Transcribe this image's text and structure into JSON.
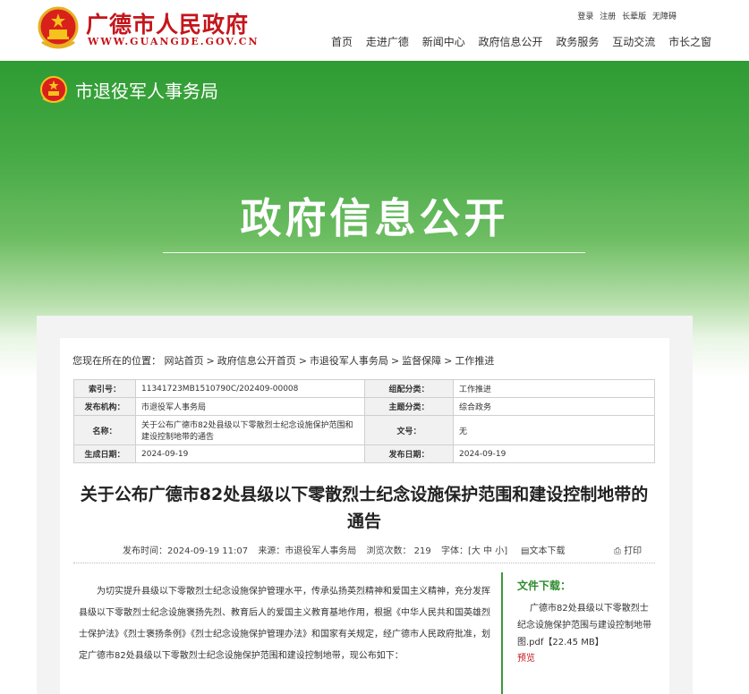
{
  "header": {
    "site_title": "广德市人民政府",
    "site_url": "WWW.GUANGDE.GOV.CN",
    "util": [
      "登录",
      "注册",
      "长辈版",
      "无障碍"
    ],
    "nav": [
      "首页",
      "走进广德",
      "新闻中心",
      "政府信息公开",
      "政务服务",
      "互动交流",
      "市长之窗"
    ]
  },
  "banner": {
    "dept_name": "市退役军人事务局",
    "big_title": "政府信息公开"
  },
  "breadcrumb": {
    "prefix": "您现在所在的位置：",
    "items": [
      "网站首页",
      "政府信息公开首页",
      "市退役军人事务局",
      "监督保障",
      "工作推进"
    ],
    "sep": ">"
  },
  "meta": {
    "index_label": "索引号：",
    "index_value": "11341723MB1510790C/202409-00008",
    "category_label": "组配分类：",
    "category_value": "工作推进",
    "org_label": "发布机构：",
    "org_value": "市退役军人事务局",
    "topic_label": "主题分类：",
    "topic_value": "综合政务",
    "name_label": "名称：",
    "name_value": "关于公布广德市82处县级以下零散烈士纪念设施保护范围和建设控制地带的通告",
    "docno_label": "文号：",
    "docno_value": "无",
    "gen_date_label": "生成日期：",
    "gen_date_value": "2024-09-19",
    "pub_date_label": "发布日期：",
    "pub_date_value": "2024-09-19"
  },
  "article": {
    "title": "关于公布广德市82处县级以下零散烈士纪念设施保护范围和建设控制地带的通告",
    "publish_time": "发布时间：2024-09-19 11:07",
    "source": "来源：市退役军人事务局",
    "views": "浏览次数： 219",
    "font_size": "字体：[大 中 小]",
    "download_link": "文本下载",
    "print_link": "打印",
    "body": "为切实提升县级以下零散烈士纪念设施保护管理水平，传承弘扬英烈精神和爱国主义精神，充分发挥县级以下零散烈士纪念设施褒扬先烈、教育后人的爱国主义教育基地作用，根据《中华人民共和国英雄烈士保护法》《烈士褒扬条例》《烈士纪念设施保护管理办法》和国家有关规定，经广德市人民政府批准，划定广德市82处县级以下零散烈士纪念设施保护范围和建设控制地带，现公布如下："
  },
  "files": {
    "heading": "文件下载：",
    "name": "广德市82处县级以下零散烈士纪念设施保护范围与建设控制地带图.pdf【22.45 MB】",
    "preview": "预览"
  },
  "colors": {
    "brand_red": "#c4161c",
    "gov_green": "#2e9b33"
  }
}
